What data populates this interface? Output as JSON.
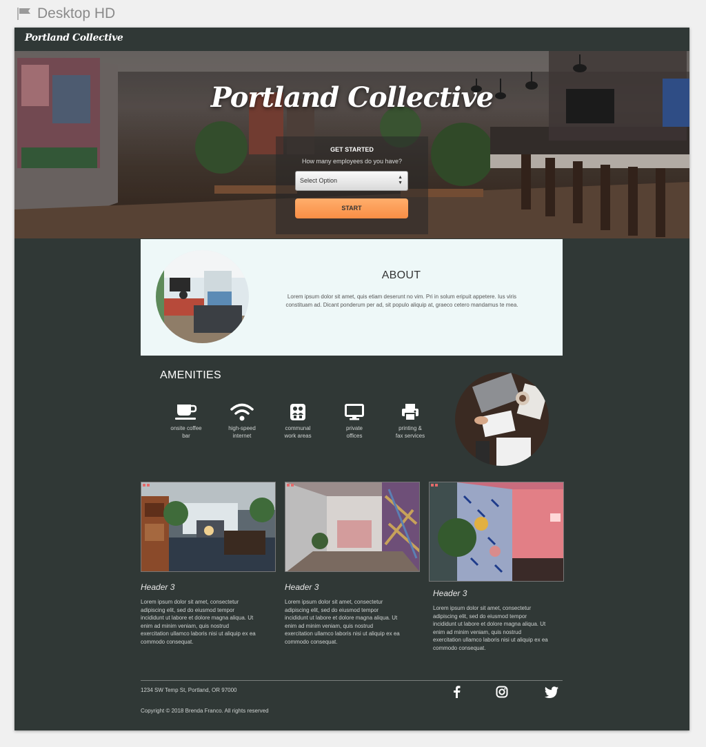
{
  "artboard": {
    "name": "Desktop HD"
  },
  "header": {
    "brand": "Portland Collective"
  },
  "hero": {
    "title": "Portland Collective",
    "form": {
      "heading": "GET STARTED",
      "question": "How many employees do you have?",
      "select_value": "Select Option",
      "button_label": "START"
    }
  },
  "about": {
    "title": "ABOUT",
    "text": "Lorem ipsum dolor sit amet, quis etiam deserunt no vim. Pri in solum eripuit appetere. Ius viris constituam ad. Dicant ponderum per ad, sit populo aliquip at, graeco cetero mandamus te mea."
  },
  "amenities": {
    "title": "AMENITIES",
    "items": [
      {
        "icon": "coffee-cup-icon",
        "line1": "onsite coffee",
        "line2": "bar"
      },
      {
        "icon": "wifi-icon",
        "line1": "high-speed",
        "line2": "internet"
      },
      {
        "icon": "people-group-icon",
        "line1": "communal",
        "line2": "work areas"
      },
      {
        "icon": "monitor-icon",
        "line1": "private",
        "line2": "offices"
      },
      {
        "icon": "printer-icon",
        "line1": "printing &",
        "line2": "fax services"
      }
    ]
  },
  "cards": [
    {
      "title": "Header 3",
      "text": "Lorem ipsum dolor sit amet, consectetur adipiscing elit, sed do eiusmod tempor incididunt ut labore et dolore magna aliqua. Ut enim ad minim veniam, quis nostrud exercitation ullamco laboris nisi ut aliquip ex ea commodo consequat."
    },
    {
      "title": "Header 3",
      "text": "Lorem ipsum dolor sit amet, consectetur adipiscing elit, sed do eiusmod tempor incididunt ut labore et dolore magna aliqua. Ut enim ad minim veniam, quis nostrud exercitation ullamco laboris nisi ut aliquip ex ea commodo consequat."
    },
    {
      "title": "Header 3",
      "text": "Lorem ipsum dolor sit amet, consectetur adipiscing elit, sed do eiusmod tempor incididunt ut labore et dolore magna aliqua. Ut enim ad minim veniam, quis nostrud exercitation ullamco laboris nisi ut aliquip ex ea commodo consequat."
    }
  ],
  "footer": {
    "address": "1234 SW Temp St, Portland, OR 97000",
    "copyright": "Copyright © 2018 Brenda Franco. All rights reserved",
    "social": [
      "facebook-icon",
      "instagram-icon",
      "twitter-icon"
    ]
  },
  "colors": {
    "page_background": "#303836",
    "about_background": "#eef8f8",
    "start_button": "#f98e45",
    "canvas": "#f0f0f0"
  }
}
